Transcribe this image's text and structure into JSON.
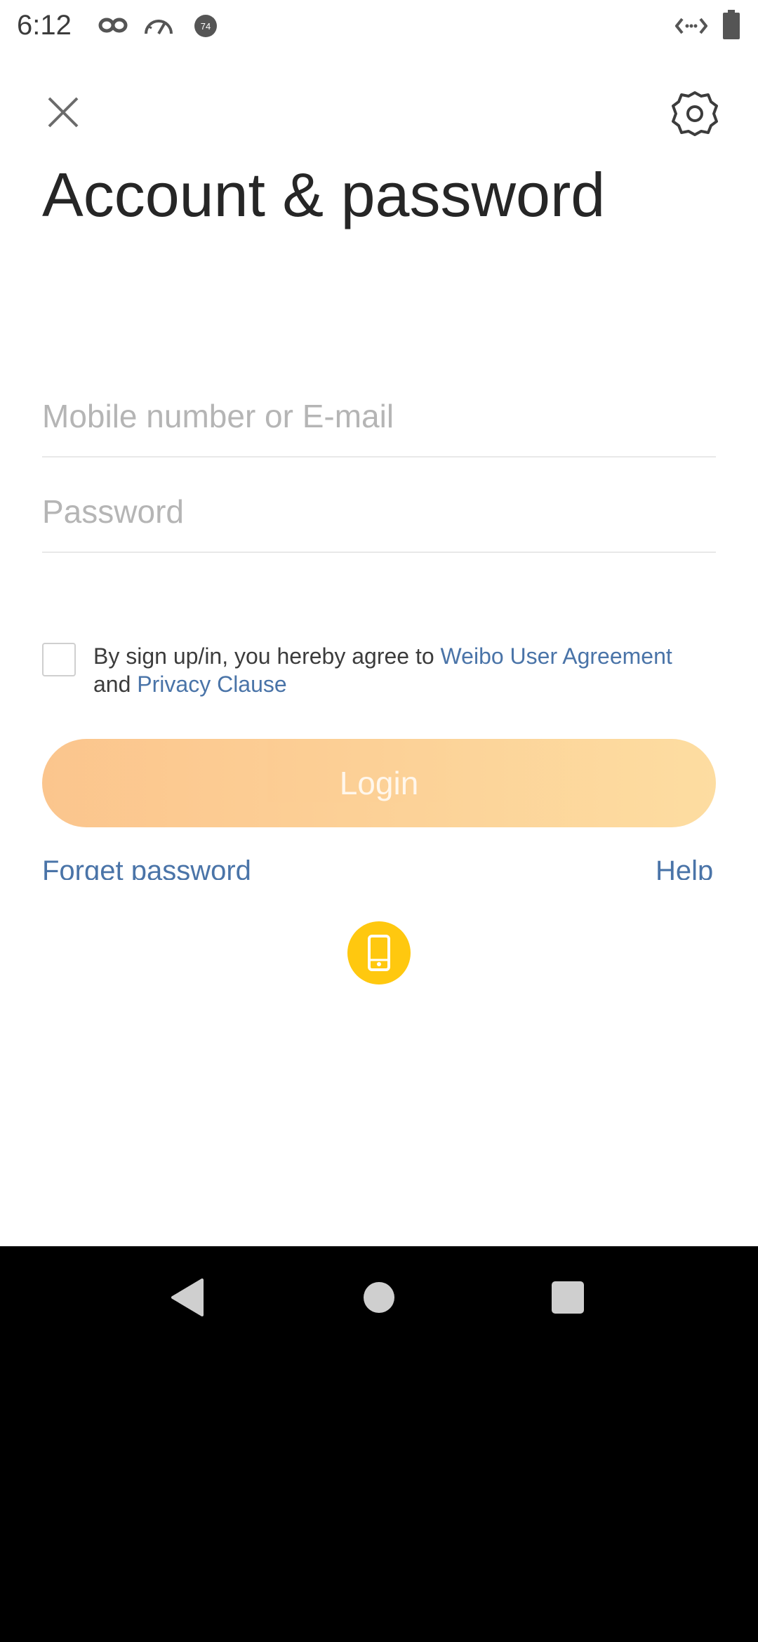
{
  "status_bar": {
    "time": "6:12",
    "icons": [
      "infinity-icon",
      "speedometer-icon",
      "badge-74-icon",
      "code-arrows-icon",
      "battery-icon"
    ],
    "badge_number": "74"
  },
  "header": {
    "title": "Account & password",
    "close_icon": "close-icon",
    "settings_icon": "gear-icon"
  },
  "form": {
    "mobile_placeholder": "Mobile number or E-mail",
    "mobile_value": "",
    "password_placeholder": "Password",
    "password_value": ""
  },
  "agreement": {
    "checked": false,
    "prefix": "By sign up/in, you hereby agree to ",
    "user_agreement_link": "Weibo User Agreement",
    "middle": " and ",
    "privacy_link": "Privacy Clause"
  },
  "login": {
    "label": "Login"
  },
  "links": {
    "forget_password": "Forget password",
    "help": "Help"
  },
  "alt_login": {
    "icon": "mobile-phone-icon"
  },
  "nav": {
    "back_icon": "back-triangle-icon",
    "home_icon": "home-circle-icon",
    "recents_icon": "recents-square-icon"
  },
  "colors": {
    "link": "#4a74a8",
    "login_gradient_start": "#fbc287",
    "login_gradient_end": "#fddb9c",
    "phone_button": "#ffc80f"
  }
}
